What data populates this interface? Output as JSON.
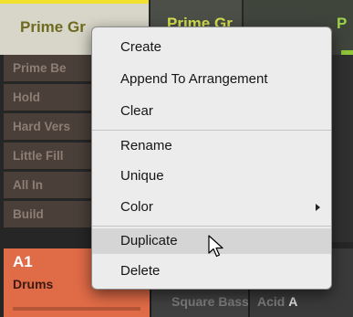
{
  "scenes": {
    "active_label": "Prime Gr",
    "second_label": "Prime Gr",
    "third_label": "P"
  },
  "patterns": [
    "Prime Be",
    "Hold",
    "Hard Vers",
    "Little Fill",
    "All In",
    "Build"
  ],
  "groups": {
    "a1_code": "A1",
    "a1_name": "Drums",
    "b_name": "Square Bass",
    "c_prefix": "Acid ",
    "c_bold": "A"
  },
  "menu": {
    "items": [
      "Create",
      "Append To Arrangement",
      "Clear",
      "Rename",
      "Unique",
      "Color",
      "Duplicate",
      "Delete"
    ],
    "highlighted": "Duplicate",
    "submenu_icon": "chevron-right-icon"
  },
  "colors": {
    "accent_yellow": "#f2e12f",
    "group_a1": "#e06b47",
    "menu_bg": "#ececec",
    "highlight": "#d5d5d5"
  }
}
